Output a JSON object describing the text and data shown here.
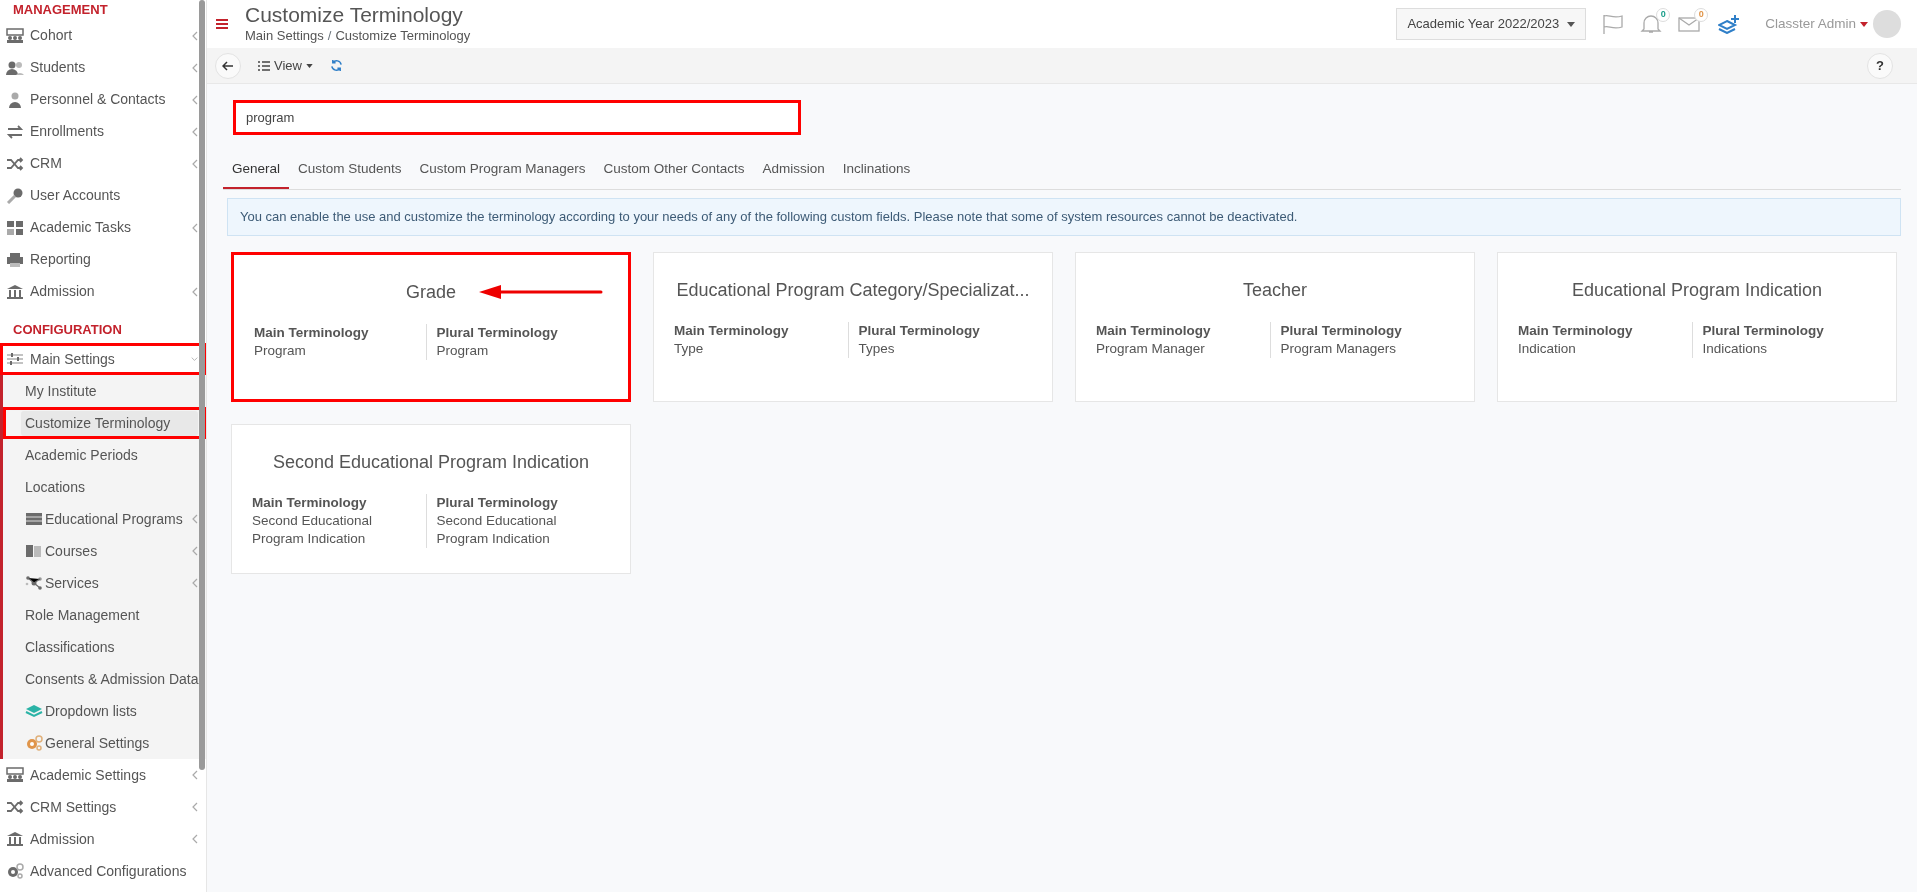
{
  "sidebar": {
    "sections": [
      {
        "title": "MANAGEMENT",
        "items": [
          {
            "label": "Cohort",
            "expandable": true,
            "expanded": false,
            "highlighted": false
          },
          {
            "label": "Students",
            "expandable": true,
            "expanded": false,
            "highlighted": false
          },
          {
            "label": "Personnel & Contacts",
            "expandable": true,
            "expanded": false,
            "highlighted": false
          },
          {
            "label": "Enrollments",
            "expandable": true,
            "expanded": false,
            "highlighted": false
          },
          {
            "label": "CRM",
            "expandable": true,
            "expanded": false,
            "highlighted": false
          },
          {
            "label": "User Accounts",
            "expandable": false,
            "expanded": false,
            "highlighted": false
          },
          {
            "label": "Academic Tasks",
            "expandable": true,
            "expanded": false,
            "highlighted": false
          },
          {
            "label": "Reporting",
            "expandable": false,
            "expanded": false,
            "highlighted": false
          },
          {
            "label": "Admission",
            "expandable": true,
            "expanded": false,
            "highlighted": false
          }
        ]
      },
      {
        "title": "CONFIGURATION",
        "items": [
          {
            "label": "Main Settings",
            "expandable": true,
            "expanded": true,
            "highlighted": true,
            "children": [
              {
                "label": "My Institute",
                "expandable": false,
                "selected": false,
                "highlighted": false
              },
              {
                "label": "Customize Terminology",
                "expandable": false,
                "selected": true,
                "highlighted": true
              },
              {
                "label": "Academic Periods",
                "expandable": false,
                "selected": false,
                "highlighted": false
              },
              {
                "label": "Locations",
                "expandable": false,
                "selected": false,
                "highlighted": false
              },
              {
                "label": "Educational Programs",
                "expandable": true,
                "selected": false,
                "highlighted": false
              },
              {
                "label": "Courses",
                "expandable": true,
                "selected": false,
                "highlighted": false
              },
              {
                "label": "Services",
                "expandable": true,
                "selected": false,
                "highlighted": false
              },
              {
                "label": "Role Management",
                "expandable": false,
                "selected": false,
                "highlighted": false
              },
              {
                "label": "Classifications",
                "expandable": false,
                "selected": false,
                "highlighted": false
              },
              {
                "label": "Consents & Admission Data",
                "expandable": false,
                "selected": false,
                "highlighted": false
              },
              {
                "label": "Dropdown lists",
                "expandable": false,
                "selected": false,
                "highlighted": false
              },
              {
                "label": "General Settings",
                "expandable": false,
                "selected": false,
                "highlighted": false
              }
            ]
          },
          {
            "label": "Academic Settings",
            "expandable": true,
            "expanded": false,
            "highlighted": false
          },
          {
            "label": "CRM Settings",
            "expandable": true,
            "expanded": false,
            "highlighted": false
          },
          {
            "label": "Admission",
            "expandable": true,
            "expanded": false,
            "highlighted": false
          },
          {
            "label": "Advanced Configurations",
            "expandable": false,
            "expanded": false,
            "highlighted": false
          }
        ]
      }
    ]
  },
  "header": {
    "title": "Customize Terminology",
    "breadcrumbs": [
      "Main Settings",
      "Customize Terminology"
    ],
    "breadcrumb_separator": "/",
    "academic_year": "Academic Year 2022/2023",
    "notifications_count": "0",
    "messages_count": "0",
    "user": "Classter Admin"
  },
  "toolbar": {
    "view_label": "View",
    "help": "?"
  },
  "search": {
    "value": "program",
    "highlighted": true
  },
  "tabs": [
    {
      "label": "General",
      "selected": true
    },
    {
      "label": "Custom Students",
      "selected": false
    },
    {
      "label": "Custom Program Managers",
      "selected": false
    },
    {
      "label": "Custom Other Contacts",
      "selected": false
    },
    {
      "label": "Admission",
      "selected": false
    },
    {
      "label": "Inclinations",
      "selected": false
    }
  ],
  "info": "You can enable the use and customize the terminology according to your needs of any of the following custom fields. Please note that some of system resources cannot be deactivated.",
  "cards": [
    {
      "title": "Grade",
      "main_label": "Main Terminology",
      "main_value": "Program",
      "plural_label": "Plural Terminology",
      "plural_value": "Program",
      "highlighted": true,
      "arrow": true
    },
    {
      "title": "Educational Program Category/Specializat...",
      "main_label": "Main Terminology",
      "main_value": "Type",
      "plural_label": "Plural Terminology",
      "plural_value": "Types",
      "highlighted": false,
      "arrow": false
    },
    {
      "title": "Teacher",
      "main_label": "Main Terminology",
      "main_value": "Program Manager",
      "plural_label": "Plural Terminology",
      "plural_value": "Program Managers",
      "highlighted": false,
      "arrow": false
    },
    {
      "title": "Educational Program Indication",
      "main_label": "Main Terminology",
      "main_value": "Indication",
      "plural_label": "Plural Terminology",
      "plural_value": "Indications",
      "highlighted": false,
      "arrow": false
    },
    {
      "title": "Second Educational Program Indication",
      "main_label": "Main Terminology",
      "main_value": "Second Educational Program Indication",
      "plural_label": "Plural Terminology",
      "plural_value": "Second Educational Program Indication",
      "highlighted": false,
      "arrow": false
    }
  ]
}
